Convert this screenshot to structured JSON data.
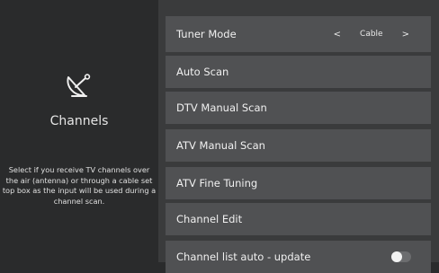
{
  "panel": {
    "title": "Channels",
    "description": "Select if you receive TV channels over the air (antenna) or through a cable set top box as the input will be used during a channel scan.",
    "icon": "satellite-dish-icon"
  },
  "menu": {
    "tuner_mode": {
      "label": "Tuner Mode",
      "value": "Cable",
      "prev_arrow": "<",
      "next_arrow": ">"
    },
    "items": [
      {
        "label": "Auto Scan"
      },
      {
        "label": "DTV Manual Scan"
      },
      {
        "label": "ATV Manual Scan"
      },
      {
        "label": "ATV Fine Tuning"
      },
      {
        "label": "Channel Edit"
      }
    ],
    "auto_update": {
      "label": "Channel list auto - update",
      "enabled": false
    }
  },
  "colors": {
    "background": "#2a2b2c",
    "menu_area": "#3a3b3c",
    "menu_item": "#505153",
    "text": "#f0f0f0"
  }
}
